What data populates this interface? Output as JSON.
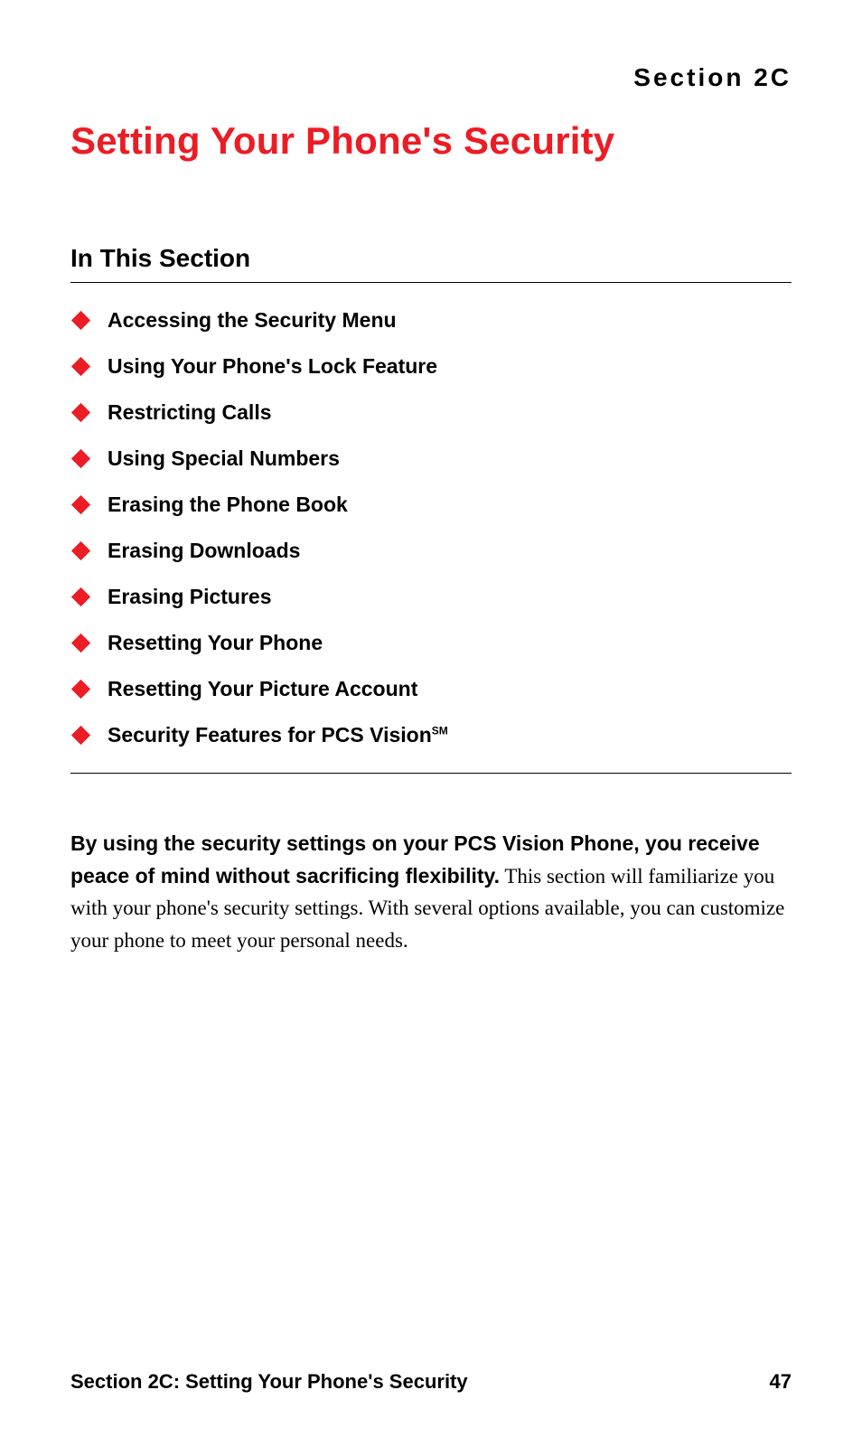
{
  "section_label": "Section 2C",
  "title": "Setting Your Phone's Security",
  "subheading": "In This Section",
  "toc": [
    {
      "label": "Accessing the Security Menu",
      "sm": false
    },
    {
      "label": "Using Your Phone's Lock Feature",
      "sm": false
    },
    {
      "label": "Restricting Calls",
      "sm": false
    },
    {
      "label": "Using Special Numbers",
      "sm": false
    },
    {
      "label": "Erasing the Phone Book",
      "sm": false
    },
    {
      "label": "Erasing Downloads",
      "sm": false
    },
    {
      "label": "Erasing Pictures",
      "sm": false
    },
    {
      "label": "Resetting Your Phone",
      "sm": false
    },
    {
      "label": "Resetting Your Picture Account",
      "sm": false
    },
    {
      "label": "Security Features for PCS Vision",
      "sm": true
    }
  ],
  "body": {
    "lead": "By using the security settings on your PCS Vision Phone, you receive peace of mind without sacrificing flexibility.",
    "rest": " This section will familiarize you with your phone's security settings. With several options available, you can customize your phone to meet your personal needs."
  },
  "footer": {
    "left": "Section 2C: Setting Your Phone's Security",
    "right": "47"
  },
  "sm_mark": "SM"
}
